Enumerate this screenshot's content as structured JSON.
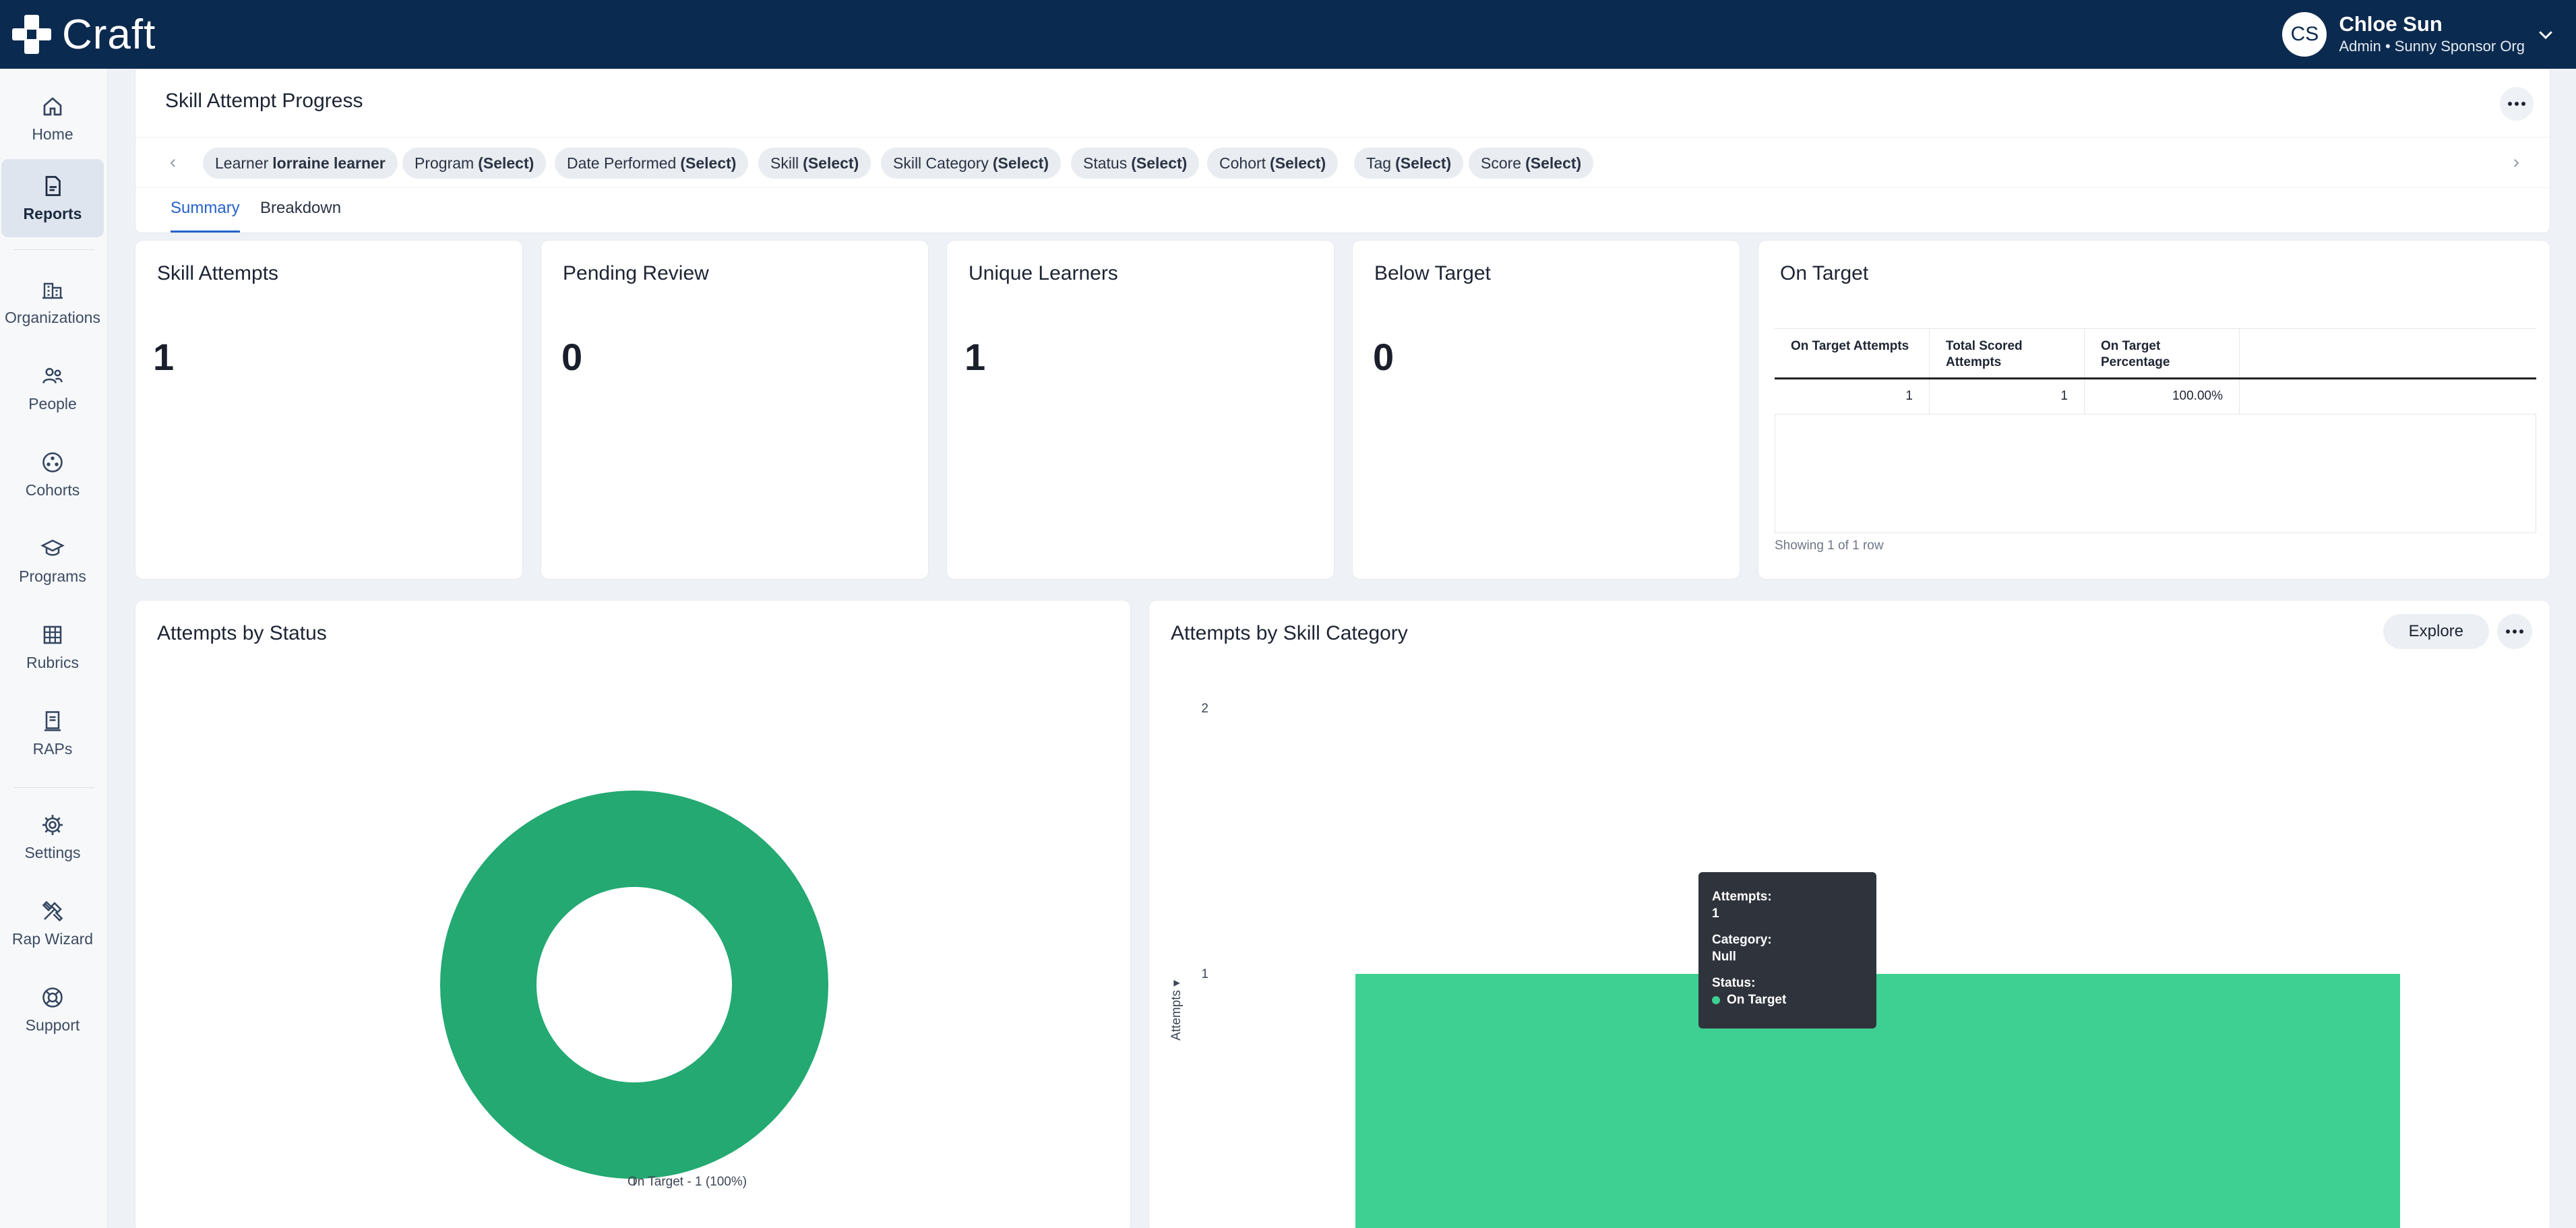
{
  "app": {
    "brand": "Craft",
    "user": {
      "initials": "CS",
      "name": "Chloe Sun",
      "role": "Admin • Sunny Sponsor Org"
    }
  },
  "sidebar": {
    "items": [
      {
        "label": "Home",
        "icon": "home-icon"
      },
      {
        "label": "Reports",
        "icon": "report-icon",
        "active": true
      },
      {
        "label": "Organizations",
        "icon": "organization-icon"
      },
      {
        "label": "People",
        "icon": "people-icon"
      },
      {
        "label": "Cohorts",
        "icon": "cohorts-icon"
      },
      {
        "label": "Programs",
        "icon": "graduation-cap-icon"
      },
      {
        "label": "Rubrics",
        "icon": "grid-icon"
      },
      {
        "label": "RAPs",
        "icon": "document-icon"
      },
      {
        "label": "Settings",
        "icon": "gear-icon"
      },
      {
        "label": "Rap Wizard",
        "icon": "tools-icon"
      },
      {
        "label": "Support",
        "icon": "lifebuoy-icon"
      }
    ]
  },
  "header": {
    "title": "Skill Attempt Progress",
    "filters": [
      {
        "label": "Learner",
        "value": "lorraine learner"
      },
      {
        "label": "Program",
        "value": "(Select)"
      },
      {
        "label": "Date Performed",
        "value": "(Select)"
      },
      {
        "label": "Skill",
        "value": "(Select)"
      },
      {
        "label": "Skill Category",
        "value": "(Select)"
      },
      {
        "label": "Status",
        "value": "(Select)"
      },
      {
        "label": "Cohort",
        "value": "(Select)"
      },
      {
        "label": "Tag",
        "value": "(Select)"
      },
      {
        "label": "Score",
        "value": "(Select)"
      }
    ],
    "tabs": [
      {
        "label": "Summary",
        "active": true
      },
      {
        "label": "Breakdown"
      }
    ]
  },
  "metrics": [
    {
      "title": "Skill Attempts",
      "value": "1"
    },
    {
      "title": "Pending Review",
      "value": "0"
    },
    {
      "title": "Unique Learners",
      "value": "1"
    },
    {
      "title": "Below Target",
      "value": "0"
    }
  ],
  "on_target": {
    "title": "On Target",
    "columns": [
      "On Target Attempts",
      "Total Scored Attempts",
      "On Target Percentage"
    ],
    "rows": [
      [
        "1",
        "1",
        "100.00%"
      ]
    ],
    "footer": "Showing 1 of 1 row"
  },
  "status_chart": {
    "title": "Attempts by Status",
    "legend_label": "On Target - 1 (100%)"
  },
  "category_chart": {
    "title": "Attempts by Skill Category",
    "explore_label": "Explore",
    "ylabel": "Attempts",
    "tooltip": {
      "attempts_label": "Attempts:",
      "attempts_value": "1",
      "category_label": "Category:",
      "category_value": "Null",
      "status_label": "Status:",
      "status_value": "On Target"
    }
  },
  "colors": {
    "on_target": "#23a971",
    "bar": "#3ecf92",
    "navy": "#0b2a4f",
    "accent": "#2562c9"
  },
  "chart_data": [
    {
      "type": "pie",
      "categories": [
        "On Target"
      ],
      "values": [
        1
      ]
    },
    {
      "type": "bar",
      "categories": [
        "Null"
      ],
      "series": [
        {
          "name": "On Target",
          "values": [
            1
          ]
        }
      ],
      "ylabel": "Attempts",
      "yticks": [
        1,
        2
      ],
      "ylim": [
        0,
        2
      ]
    }
  ]
}
